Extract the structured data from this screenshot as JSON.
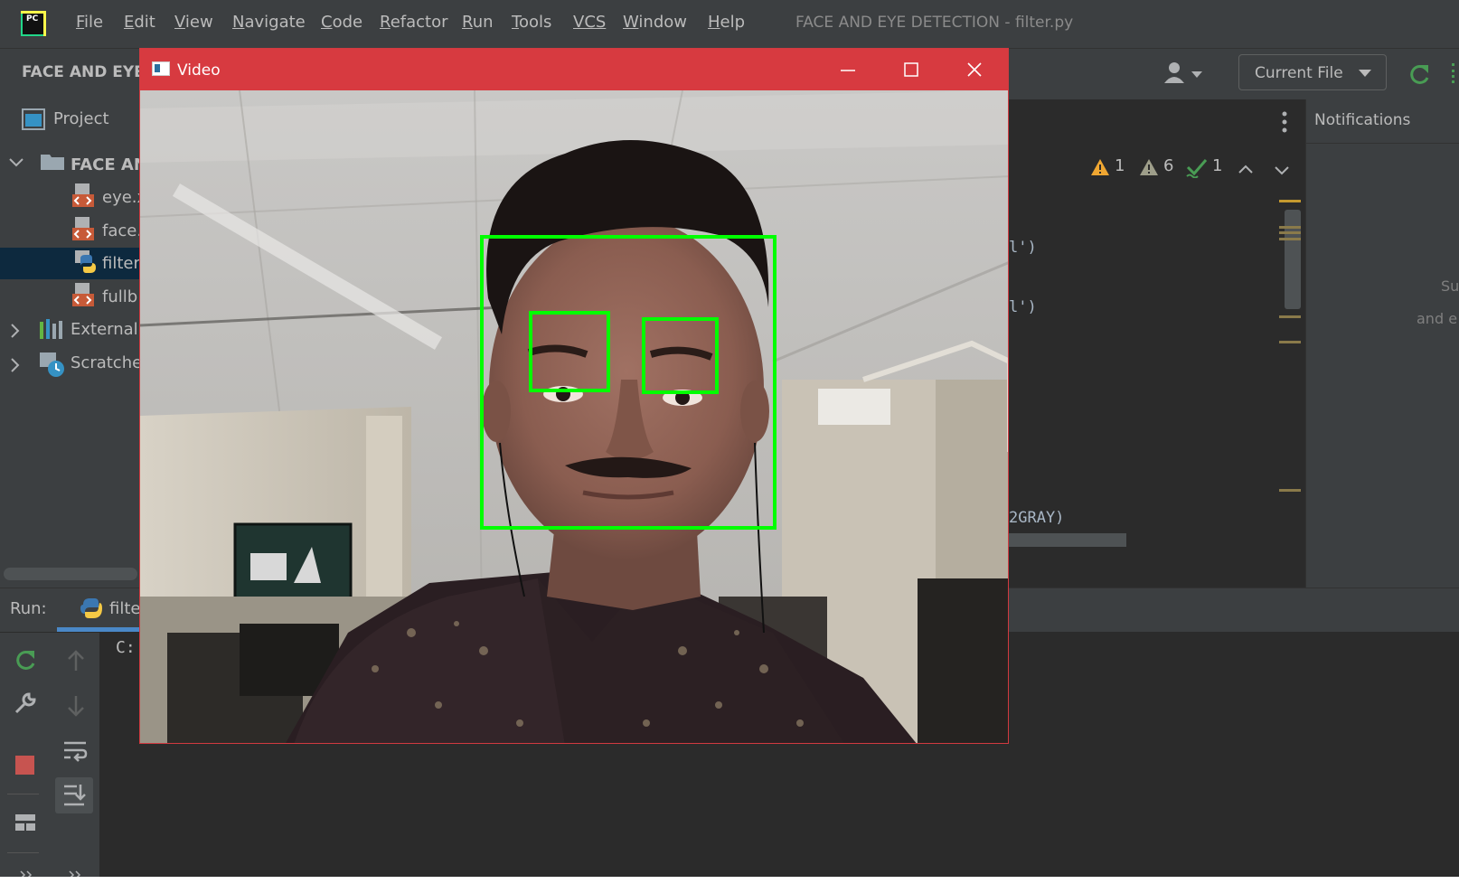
{
  "menubar": {
    "items": [
      {
        "label": "File",
        "hot": "F",
        "rest": "ile"
      },
      {
        "label": "Edit",
        "hot": "E",
        "rest": "dit"
      },
      {
        "label": "View",
        "hot": "V",
        "rest": "iew"
      },
      {
        "label": "Navigate",
        "hot": "N",
        "rest": "avigate"
      },
      {
        "label": "Code",
        "hot": "C",
        "rest": "ode"
      },
      {
        "label": "Refactor",
        "hot": "R",
        "rest": "efactor"
      },
      {
        "label": "Run",
        "hot": "R",
        "rest": "un"
      },
      {
        "label": "Tools",
        "hot": "T",
        "rest": "ools"
      },
      {
        "label": "VCS",
        "hot": "VCS",
        "rest": ""
      },
      {
        "label": "Window",
        "hot": "W",
        "rest": "indow"
      },
      {
        "label": "Help",
        "hot": "H",
        "rest": "elp"
      }
    ],
    "window_title": "FACE AND EYE DETECTION - filter.py"
  },
  "toolbar": {
    "project_name": "FACE AND EYE",
    "run_config": "Current File"
  },
  "project_panel": {
    "header": "Project",
    "tree": [
      {
        "label": "FACE AN",
        "icon": "folder-icon"
      },
      {
        "label": "eye.x",
        "icon": "xml-file-icon"
      },
      {
        "label": "face.",
        "icon": "xml-file-icon"
      },
      {
        "label": "filter",
        "icon": "python-file-icon",
        "selected": true
      },
      {
        "label": "fullb",
        "icon": "xml-file-icon"
      },
      {
        "label": "External",
        "icon": "library-icon"
      },
      {
        "label": "Scratches",
        "icon": "scratches-icon"
      }
    ]
  },
  "editor": {
    "inspections": {
      "warnings": "1",
      "weak_warnings": "6",
      "typos": "1"
    },
    "code_lines": [
      "l')",
      "l')",
      "2GRAY)"
    ]
  },
  "notifications": {
    "title": "Notifications",
    "text1": "Su",
    "text2": "and e"
  },
  "run_panel": {
    "label": "Run:",
    "tab": "filte",
    "console_text": "C:"
  },
  "video_window": {
    "title": "Video",
    "detections": {
      "faces": 1,
      "eyes": 2
    }
  },
  "colors": {
    "detection_box": "#00ff00",
    "video_titlebar": "#d73a40",
    "ide_background": "#2b2b2b",
    "selection": "#0d293e"
  }
}
